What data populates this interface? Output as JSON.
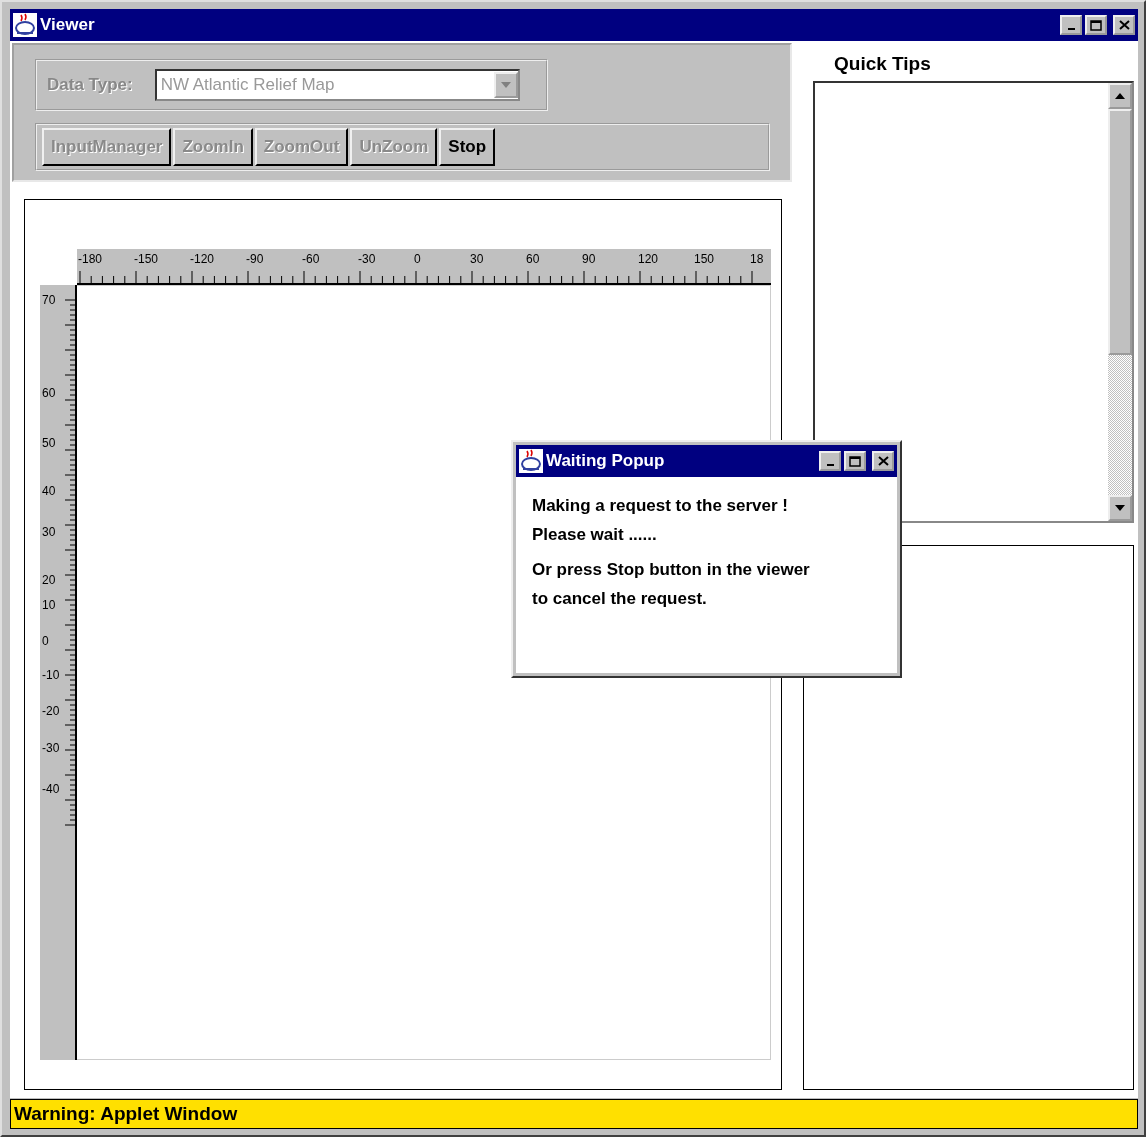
{
  "window": {
    "title": "Viewer"
  },
  "controls": {
    "data_type": {
      "label": "Data Type:",
      "value": "NW Atlantic Relief Map",
      "disabled": true
    },
    "buttons": [
      {
        "label": "InputManager",
        "disabled": true
      },
      {
        "label": "ZoomIn",
        "disabled": true
      },
      {
        "label": "ZoomOut",
        "disabled": true
      },
      {
        "label": "UnZoom",
        "disabled": true
      },
      {
        "label": "Stop",
        "disabled": false
      }
    ]
  },
  "map": {
    "top_ruler_labels": [
      "-180",
      "-150",
      "-120",
      "-90",
      "-60",
      "-30",
      "0",
      "30",
      "60",
      "90",
      "120",
      "150",
      "18"
    ],
    "left_ruler_labels": [
      "70",
      "60",
      "50",
      "40",
      "30",
      "20",
      "10",
      "0",
      "-10",
      "-20",
      "-30",
      "-40"
    ]
  },
  "quick_tips": {
    "title": "Quick Tips"
  },
  "popup": {
    "title": "Waiting Popup",
    "lines": [
      "Making a request to the server !",
      "Please wait ......",
      "Or press Stop button in the viewer",
      "to cancel the request."
    ]
  },
  "status_bar": {
    "text": "Warning: Applet Window"
  }
}
